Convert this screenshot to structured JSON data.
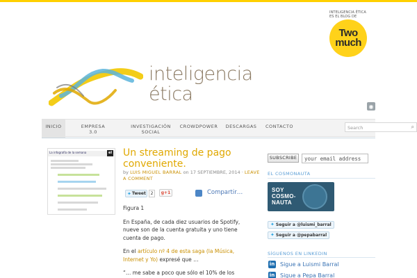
{
  "colors": {
    "accent": "#ffd000",
    "title": "#e0a800",
    "link": "#c98f00",
    "sidebar_heading": "#5a9ed6",
    "logo_text": "#8b7a63"
  },
  "brand": {
    "caption": "INTELIGENCIA ÉTICA ES EL BLOG DE",
    "line1": "Two",
    "line2": "much"
  },
  "logo": {
    "line1": "inteligencia",
    "line2": "ética"
  },
  "rss_icon": "rss-icon",
  "nav": {
    "items": [
      {
        "label": "INICIO"
      },
      {
        "label": "EMPRESA 3.0"
      },
      {
        "label": "INVESTIGACIÓN SOCIAL"
      },
      {
        "label": "CROWDPOWER"
      },
      {
        "label": "DESCARGAS"
      },
      {
        "label": "CONTACTO"
      }
    ],
    "search_placeholder": "Search"
  },
  "thumbnail": {
    "header": "La infografía de la semana",
    "badge": "el"
  },
  "post": {
    "title": "Un streaming de pago conveniente.",
    "by": "by",
    "author": "LUIS MIGUEL BARRAL",
    "on": "on",
    "date": "17 SEPTIEMBRE, 2014",
    "sep": "·",
    "comment": "LEAVE A COMMENT",
    "tweet": "Tweet",
    "tweet_count": "2",
    "gplus": "g+1",
    "share": "Compartir…",
    "figure": "Figura 1",
    "p1": "En España, de cada diez usuarios de Spotify, nueve son de la cuenta gratuita y uno tiene cuenta de pago.",
    "p2_before": "En el ",
    "p2_link": "artículo nº 4 de esta saga (la Música, Internet y Yo)",
    "p2_after": " expresé que …",
    "p3": "“… me sabe a poco que sólo el 10% de los"
  },
  "sidebar": {
    "subscribe": "SUBSCRIBE",
    "email_placeholder": "your email address",
    "cosmonauta_heading": "EL COSMONAUTA",
    "banner_line1": "SOY",
    "banner_line2": "COSMO-",
    "banner_line3": "NAUTA",
    "follow1": "Seguir a @luismi_barral",
    "follow2": "Seguir a @pepabarral",
    "linkedin_heading": "SÍGUENOS EN LINKEDIN",
    "li1": "Sigue a Luismi Barral",
    "li2": "Sigue a Pepa Barral"
  }
}
